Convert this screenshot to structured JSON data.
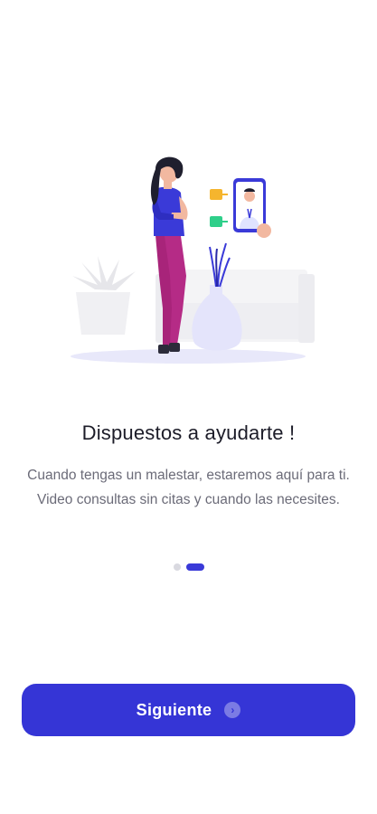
{
  "onboarding": {
    "title": "Dispuestos a ayudarte !",
    "description": "Cuando tengas un malestar, estaremos aquí para ti. Video consultas sin citas y cuando las necesites.",
    "page_indicator": {
      "total": 2,
      "current": 2
    },
    "next_button_label": "Siguiente",
    "next_button_icon": "chevron-right-circle-icon"
  },
  "colors": {
    "primary": "#3535d6",
    "title": "#1c1c28",
    "body_text": "#6b6b78",
    "inactive_dot": "#d9d9e0"
  },
  "illustration": "woman-video-call-doctor-illustration"
}
